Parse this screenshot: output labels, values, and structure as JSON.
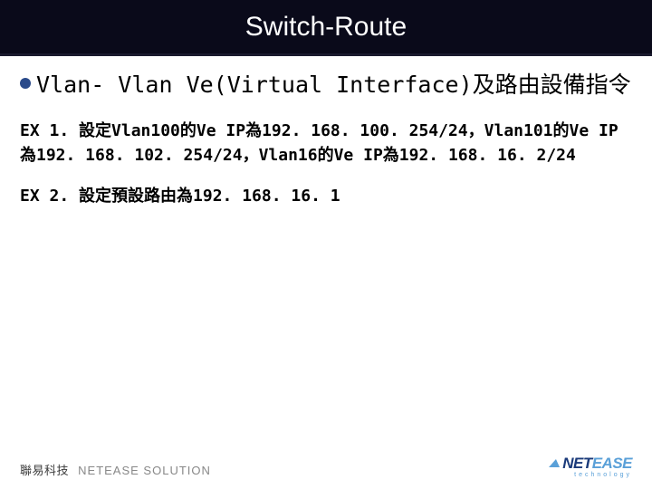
{
  "title": "Switch-Route",
  "heading": "Vlan- Vlan Ve(Virtual Interface)及路由設備指令",
  "ex1": "EX 1. 設定Vlan100的Ve IP為192. 168. 100. 254/24，Vlan101的Ve IP為192. 168. 102. 254/24，Vlan16的Ve IP為192. 168. 16. 2/24",
  "ex2": "EX 2. 設定預設路由為192. 168. 16. 1",
  "footer": {
    "company_cn": "聯易科技",
    "company_en": "NETEASE SOLUTION"
  },
  "logo": {
    "net": "NET",
    "ease": "EASE",
    "sub": "technology"
  }
}
